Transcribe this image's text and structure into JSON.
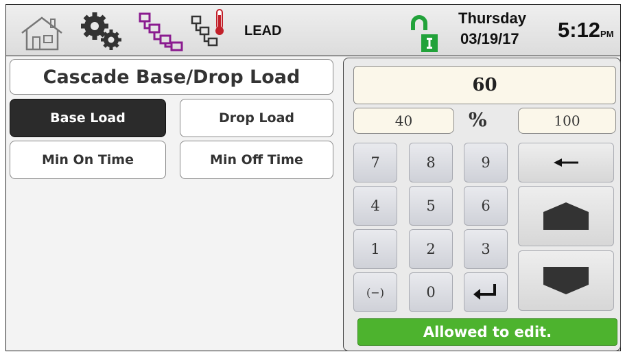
{
  "header": {
    "mode_label": "LEAD",
    "day": "Thursday",
    "date": "03/19/17",
    "time": "5:12",
    "ampm": "PM",
    "icons": [
      "home-icon",
      "settings-gears-icon",
      "cascade-network-icon",
      "cascade-temperature-icon",
      "lock-status-icon"
    ]
  },
  "left": {
    "title": "Cascade Base/Drop Load",
    "buttons": {
      "base_load": "Base Load",
      "drop_load": "Drop Load",
      "min_on_time": "Min On Time",
      "min_off_time": "Min Off Time"
    }
  },
  "keypad": {
    "value": "60",
    "min": "40",
    "unit": "%",
    "max": "100",
    "keys": {
      "k7": "7",
      "k8": "8",
      "k9": "9",
      "k4": "4",
      "k5": "5",
      "k6": "6",
      "k1": "1",
      "k2": "2",
      "k3": "3",
      "neg": "(−)",
      "k0": "0"
    },
    "status": "Allowed to edit."
  },
  "colors": {
    "status_green": "#4db32e",
    "active_button": "#2b2b2b",
    "purple_icon": "#8a1b8f",
    "lock_green": "#22a23a",
    "thermo_red": "#c2202a"
  }
}
